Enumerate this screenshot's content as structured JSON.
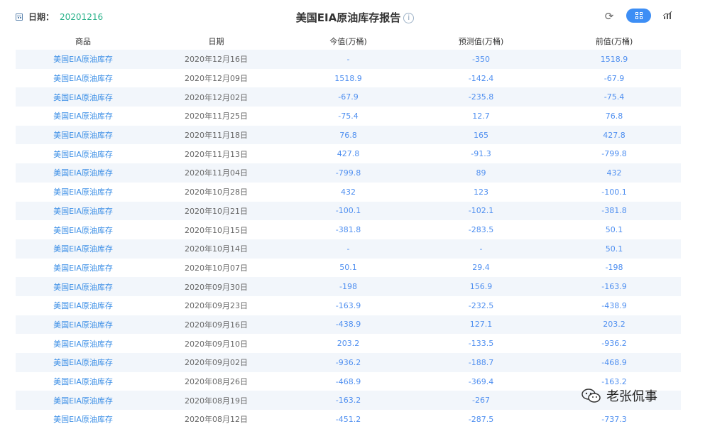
{
  "header": {
    "date_label": "日期：",
    "date_value": "20201216",
    "title": "美国EIA原油库存报告",
    "info_symbol": "i",
    "refresh_symbol": "⟳"
  },
  "table": {
    "columns": [
      "商品",
      "日期",
      "今值(万桶)",
      "预测值(万桶)",
      "前值(万桶)"
    ],
    "rows": [
      [
        "美国EIA原油库存",
        "2020年12月16日",
        "-",
        "-350",
        "1518.9"
      ],
      [
        "美国EIA原油库存",
        "2020年12月09日",
        "1518.9",
        "-142.4",
        "-67.9"
      ],
      [
        "美国EIA原油库存",
        "2020年12月02日",
        "-67.9",
        "-235.8",
        "-75.4"
      ],
      [
        "美国EIA原油库存",
        "2020年11月25日",
        "-75.4",
        "12.7",
        "76.8"
      ],
      [
        "美国EIA原油库存",
        "2020年11月18日",
        "76.8",
        "165",
        "427.8"
      ],
      [
        "美国EIA原油库存",
        "2020年11月13日",
        "427.8",
        "-91.3",
        "-799.8"
      ],
      [
        "美国EIA原油库存",
        "2020年11月04日",
        "-799.8",
        "89",
        "432"
      ],
      [
        "美国EIA原油库存",
        "2020年10月28日",
        "432",
        "123",
        "-100.1"
      ],
      [
        "美国EIA原油库存",
        "2020年10月21日",
        "-100.1",
        "-102.1",
        "-381.8"
      ],
      [
        "美国EIA原油库存",
        "2020年10月15日",
        "-381.8",
        "-283.5",
        "50.1"
      ],
      [
        "美国EIA原油库存",
        "2020年10月14日",
        "-",
        "-",
        "50.1"
      ],
      [
        "美国EIA原油库存",
        "2020年10月07日",
        "50.1",
        "29.4",
        "-198"
      ],
      [
        "美国EIA原油库存",
        "2020年09月30日",
        "-198",
        "156.9",
        "-163.9"
      ],
      [
        "美国EIA原油库存",
        "2020年09月23日",
        "-163.9",
        "-232.5",
        "-438.9"
      ],
      [
        "美国EIA原油库存",
        "2020年09月16日",
        "-438.9",
        "127.1",
        "203.2"
      ],
      [
        "美国EIA原油库存",
        "2020年09月10日",
        "203.2",
        "-133.5",
        "-936.2"
      ],
      [
        "美国EIA原油库存",
        "2020年09月02日",
        "-936.2",
        "-188.7",
        "-468.9"
      ],
      [
        "美国EIA原油库存",
        "2020年08月26日",
        "-468.9",
        "-369.4",
        "-163.2"
      ],
      [
        "美国EIA原油库存",
        "2020年08月19日",
        "-163.2",
        "-267",
        ""
      ],
      [
        "美国EIA原油库存",
        "2020年08月12日",
        "-451.2",
        "-287.5",
        "-737.3"
      ]
    ]
  },
  "watermark": {
    "text": "老张侃事"
  },
  "colors": {
    "accent": "#3d8ef5",
    "date_value": "#2ab28a",
    "row_stripe": "#f2f6fb",
    "link": "#3a8ee6"
  },
  "icons": {
    "calendar": "calendar-icon",
    "info": "info-icon",
    "refresh": "refresh-icon",
    "table_view": "table-view-icon",
    "chart_view": "chart-view-icon",
    "wechat": "wechat-icon"
  }
}
